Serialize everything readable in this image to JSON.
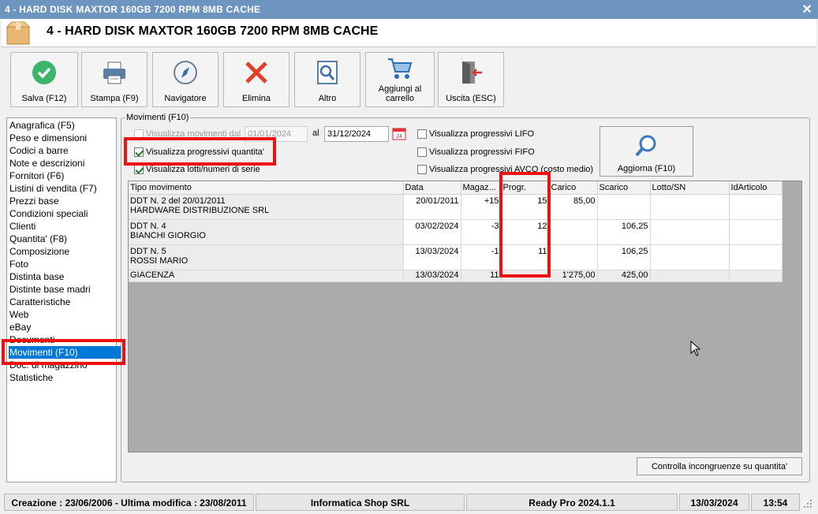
{
  "window": {
    "title": "4 - HARD DISK MAXTOR 160GB 7200 RPM 8MB CACHE",
    "close_glyph": "✕"
  },
  "header": {
    "title": "4 - HARD DISK MAXTOR 160GB 7200 RPM 8MB CACHE",
    "icon": "box-icon"
  },
  "toolbar": {
    "save": "Salva (F12)",
    "print": "Stampa (F9)",
    "navigator": "Navigatore",
    "delete": "Elimina",
    "other": "Altro",
    "add_cart_line1": "Aggiungi al",
    "add_cart_line2": "carrello",
    "exit": "Uscita (ESC)"
  },
  "sidebar": {
    "items": [
      "Anagrafica (F5)",
      "Peso e dimensioni",
      "Codici a barre",
      "Note e descrizioni",
      "Fornitori (F6)",
      "Listini di vendita (F7)",
      "Prezzi base",
      "Condizioni speciali",
      "Clienti",
      "Quantita' (F8)",
      "Composizione",
      "Foto",
      "Distinta base",
      "Distinte base madri",
      "Caratteristiche",
      "Web",
      "eBay",
      "Documenti",
      "Movimenti (F10)",
      "Doc. di magazzino",
      "Statistiche"
    ],
    "selected_index": 18
  },
  "movimenti": {
    "group_label": "Movimenti (F10)",
    "show_from_label": "Visualizza movimenti dal",
    "date_from": "01/01/2024",
    "al_label": "al",
    "date_to": "31/12/2024",
    "show_qty_progressive": "Visualizza progressivi quantita'",
    "show_lots": "Visualizza lotti/numeri di serie",
    "lifo": "Visualizza progressivi LIFO",
    "fifo": "Visualizza progressivi FIFO",
    "avco": "Visualizza progressivi AVCO (costo medio)",
    "refresh": "Aggiorna (F10)",
    "check_button": "Controlla incongruenze su quantita'"
  },
  "grid": {
    "columns": [
      "Tipo movimento",
      "Data",
      "Magaz...",
      "Progr.",
      "Carico",
      "Scarico",
      "Lotto/SN",
      "IdArticolo"
    ],
    "rows": [
      {
        "tipo1": "DDT N. 2 del 20/01/2011",
        "tipo2": "HARDWARE DISTRIBUZIONE SRL",
        "data": "20/01/2011",
        "magaz": "+15",
        "progr": "15",
        "carico": "85,00",
        "scarico": "",
        "lotto": "",
        "id": ""
      },
      {
        "tipo1": "DDT N. 4",
        "tipo2": "BIANCHI GIORGIO",
        "data": "03/02/2024",
        "magaz": "-3",
        "progr": "12",
        "carico": "",
        "scarico": "106,25",
        "lotto": "",
        "id": ""
      },
      {
        "tipo1": "DDT N. 5",
        "tipo2": "ROSSI MARIO",
        "data": "13/03/2024",
        "magaz": "-1",
        "progr": "11",
        "carico": "",
        "scarico": "106,25",
        "lotto": "",
        "id": ""
      }
    ],
    "giacenza": {
      "label": "GIACENZA",
      "data": "13/03/2024",
      "magaz": "11",
      "progr": "",
      "carico": "1'275,00",
      "scarico": "425,00"
    }
  },
  "status": {
    "created": "Creazione : 23/06/2006 - Ultima modifica : 23/08/2011",
    "company": "Informatica Shop SRL",
    "version": "Ready Pro 2024.1.1",
    "date": "13/03/2024",
    "time": "13:54"
  },
  "colors": {
    "highlight": "#e11",
    "selection": "#0078d7",
    "titlebar": "#6d95bf"
  }
}
